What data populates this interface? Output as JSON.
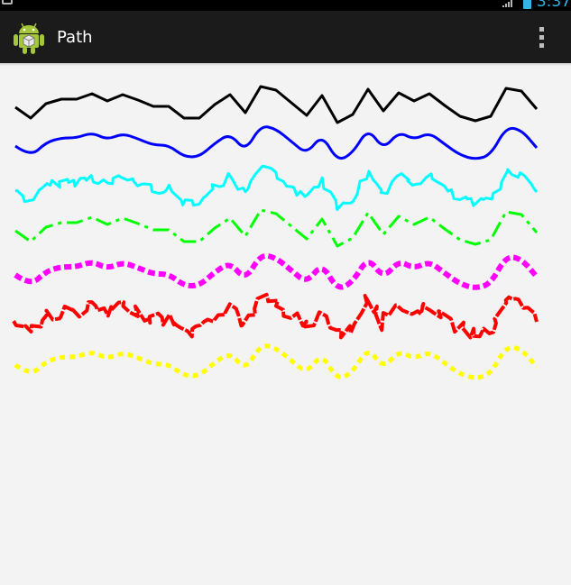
{
  "status_bar": {
    "time": "3:37",
    "icons": [
      "notification-icon",
      "signal-icon",
      "battery-icon"
    ]
  },
  "action_bar": {
    "title": "Path",
    "app_icon": "android-icon",
    "menu_icon": "overflow-menu-icon"
  },
  "canvas": {
    "background": "#f3f3f3",
    "paths": [
      {
        "name": "path-straight",
        "color": "#000000",
        "effect": "none"
      },
      {
        "name": "path-corner",
        "color": "#0000ff",
        "effect": "corner"
      },
      {
        "name": "path-discrete",
        "color": "#00ffff",
        "effect": "discrete"
      },
      {
        "name": "path-dash",
        "color": "#00ff00",
        "effect": "dash"
      },
      {
        "name": "path-dash-corner",
        "color": "#ff00ff",
        "effect": "dash-corner"
      },
      {
        "name": "path-discrete-dash",
        "color": "#ff0000",
        "effect": "discrete-dash"
      },
      {
        "name": "path-compose",
        "color": "#ffff00",
        "effect": "compose"
      }
    ]
  }
}
